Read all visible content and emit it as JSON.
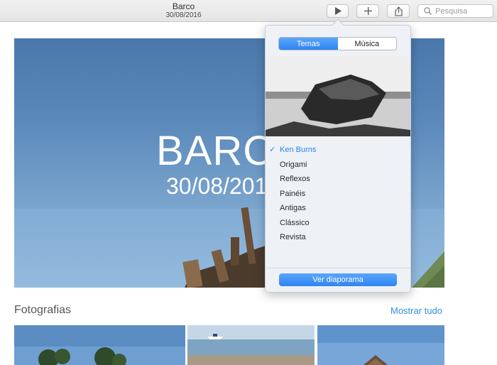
{
  "window": {
    "title": "Barco",
    "subtitle": "30/08/2016"
  },
  "toolbar": {
    "play_icon": "play-icon",
    "add_icon": "plus-icon",
    "share_icon": "share-icon",
    "search_icon": "magnifier-icon",
    "search_placeholder": "Pesquisa"
  },
  "memory": {
    "title": "BARCO",
    "date": "30/08/2016"
  },
  "photos": {
    "section_title": "Fotografias",
    "show_all": "Mostrar tudo"
  },
  "popover": {
    "tabs": [
      {
        "label": "Temas",
        "selected": true
      },
      {
        "label": "Música",
        "selected": false
      }
    ],
    "themes": [
      {
        "label": "Ken Burns",
        "selected": true
      },
      {
        "label": "Origami",
        "selected": false
      },
      {
        "label": "Reflexos",
        "selected": false
      },
      {
        "label": "Painéis",
        "selected": false
      },
      {
        "label": "Antigas",
        "selected": false
      },
      {
        "label": "Clássico",
        "selected": false
      },
      {
        "label": "Revista",
        "selected": false
      }
    ],
    "check_glyph": "✓",
    "action_button": "Ver diaporama"
  },
  "colors": {
    "accent": "#2f84f3",
    "link": "#2f8fe0"
  }
}
